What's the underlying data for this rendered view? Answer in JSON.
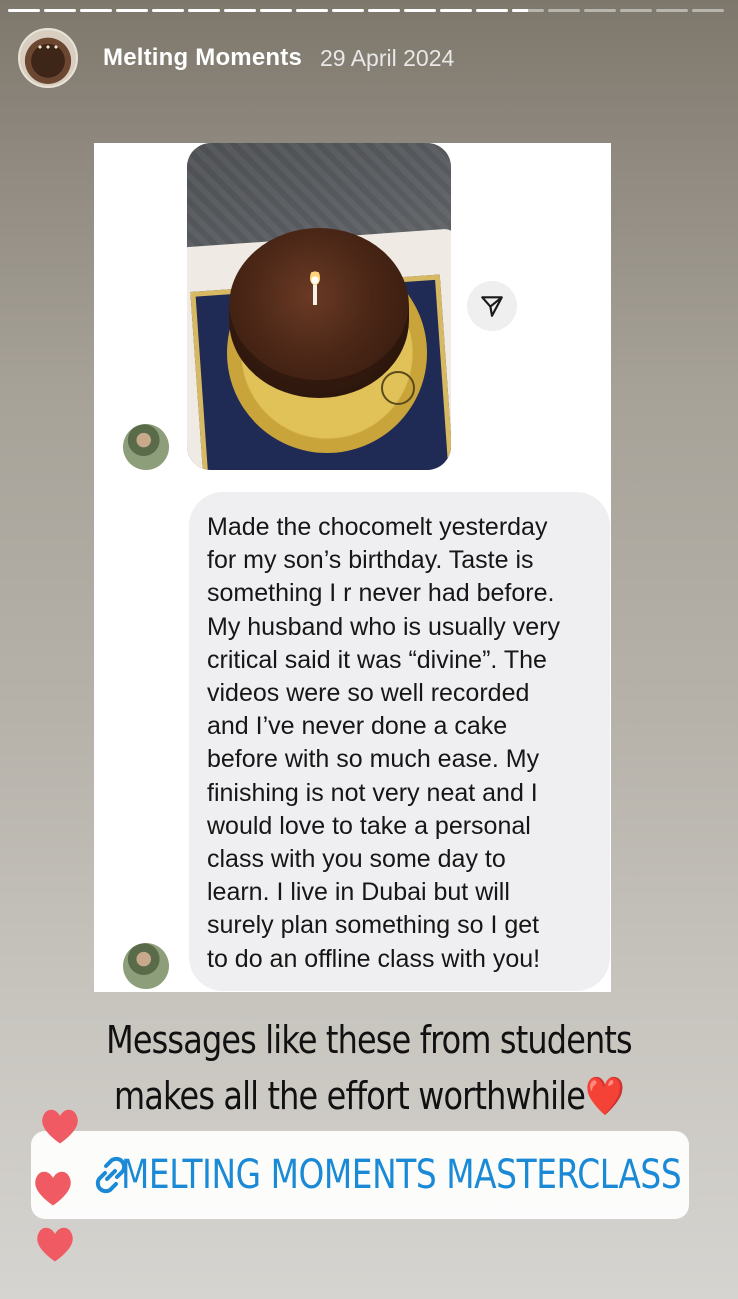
{
  "story": {
    "segments": [
      1,
      1,
      1,
      1,
      1,
      1,
      1,
      1,
      1,
      1,
      1,
      1,
      1,
      1,
      0.5,
      0,
      0,
      0,
      0,
      0
    ]
  },
  "header": {
    "username": "Melting Moments",
    "date": "29 April 2024"
  },
  "chat": {
    "message": "Made the chocomelt yesterday\nfor my son’s birthday. Taste is\nsomething I r never had before.\nMy husband who is usually very\ncritical said it was “divine”. The\nvideos were so well recorded\nand I’ve never done a cake\nbefore with so much ease. My\nfinishing is not very neat and I\nwould love to take a personal\nclass with you some day to\nlearn. I live in Dubai but will\nsurely plan something so I get\nto do an offline class with you!"
  },
  "caption": {
    "text": "Messages like these from students\nmakes all the effort worthwhile",
    "emoji": "❤️"
  },
  "link_sticker": {
    "label": "MELTING MOMENTS MASTERCLASS"
  },
  "colors": {
    "link": "#1b8ad6",
    "heart": "#e0232e"
  }
}
